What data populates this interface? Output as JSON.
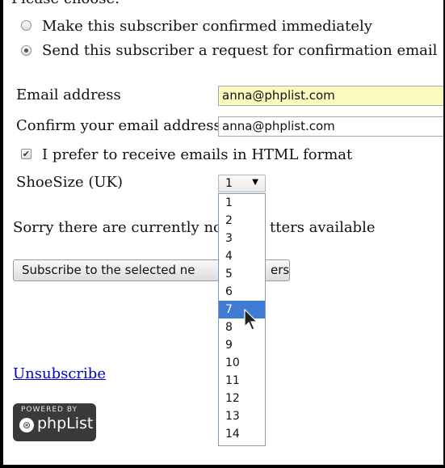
{
  "form": {
    "heading": "Please choose:",
    "options": [
      {
        "label": "Make this subscriber confirmed immediately",
        "checked": false
      },
      {
        "label": "Send this subscriber a request for confirmation email",
        "checked": true
      }
    ],
    "email_label": "Email address",
    "email_value": "anna@phplist.com",
    "confirm_label": "Confirm your email address",
    "confirm_value": "anna@phplist.com",
    "html_pref_label": "I prefer to receive emails in HTML format",
    "html_pref_checked": true,
    "checkbox_mark": "✔",
    "shoesize_label": "ShoeSize (UK)",
    "shoesize_value": "1",
    "select_arrow": "▼",
    "shoesize_options": [
      "1",
      "2",
      "3",
      "4",
      "5",
      "6",
      "7",
      "8",
      "9",
      "10",
      "11",
      "12",
      "13",
      "14"
    ],
    "shoesize_highlighted": "7",
    "newsletter_msg_start": "Sorry there are currently no n",
    "newsletter_msg_end": "tters available",
    "subscribe_button_start": "Subscribe to the selected ne",
    "subscribe_button_end": "ers",
    "unsubscribe_link": "Unsubscribe"
  },
  "badge": {
    "top_text": "POWERED BY",
    "name": "phpList",
    "logo_glyph": "⊛",
    "icon": "phplist-logo-icon"
  },
  "cursor_icon": "arrow-pointer-icon"
}
